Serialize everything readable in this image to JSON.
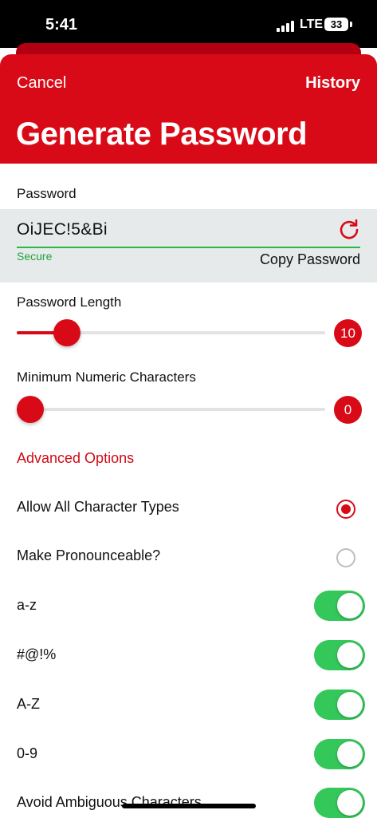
{
  "status": {
    "time": "5:41",
    "network": "LTE",
    "battery": "33"
  },
  "header": {
    "cancel_label": "Cancel",
    "history_label": "History",
    "title": "Generate Password"
  },
  "password": {
    "label": "Password",
    "value": "OiJEC!5&Bi",
    "strength": "Secure",
    "copy_label": "Copy Password",
    "refresh_icon": "refresh-icon"
  },
  "length": {
    "label": "Password Length",
    "value": "10",
    "fraction": 0.13
  },
  "numeric": {
    "label": "Minimum Numeric Characters",
    "value": "0",
    "fraction": 0.0
  },
  "advanced": {
    "label": "Advanced Options"
  },
  "options": {
    "allow_all": {
      "label": "Allow All Character Types",
      "selected": true
    },
    "pronounceable": {
      "label": "Make Pronounceable?",
      "selected": false
    }
  },
  "toggles": [
    {
      "label": "a-z",
      "on": true
    },
    {
      "label": "#@!%",
      "on": true
    },
    {
      "label": "A-Z",
      "on": true
    },
    {
      "label": "0-9",
      "on": true
    },
    {
      "label": "Avoid Ambiguous Characters",
      "on": true
    }
  ],
  "colors": {
    "accent": "#d90a17",
    "toggle_on": "#34c759",
    "secure": "#1ea43b"
  }
}
